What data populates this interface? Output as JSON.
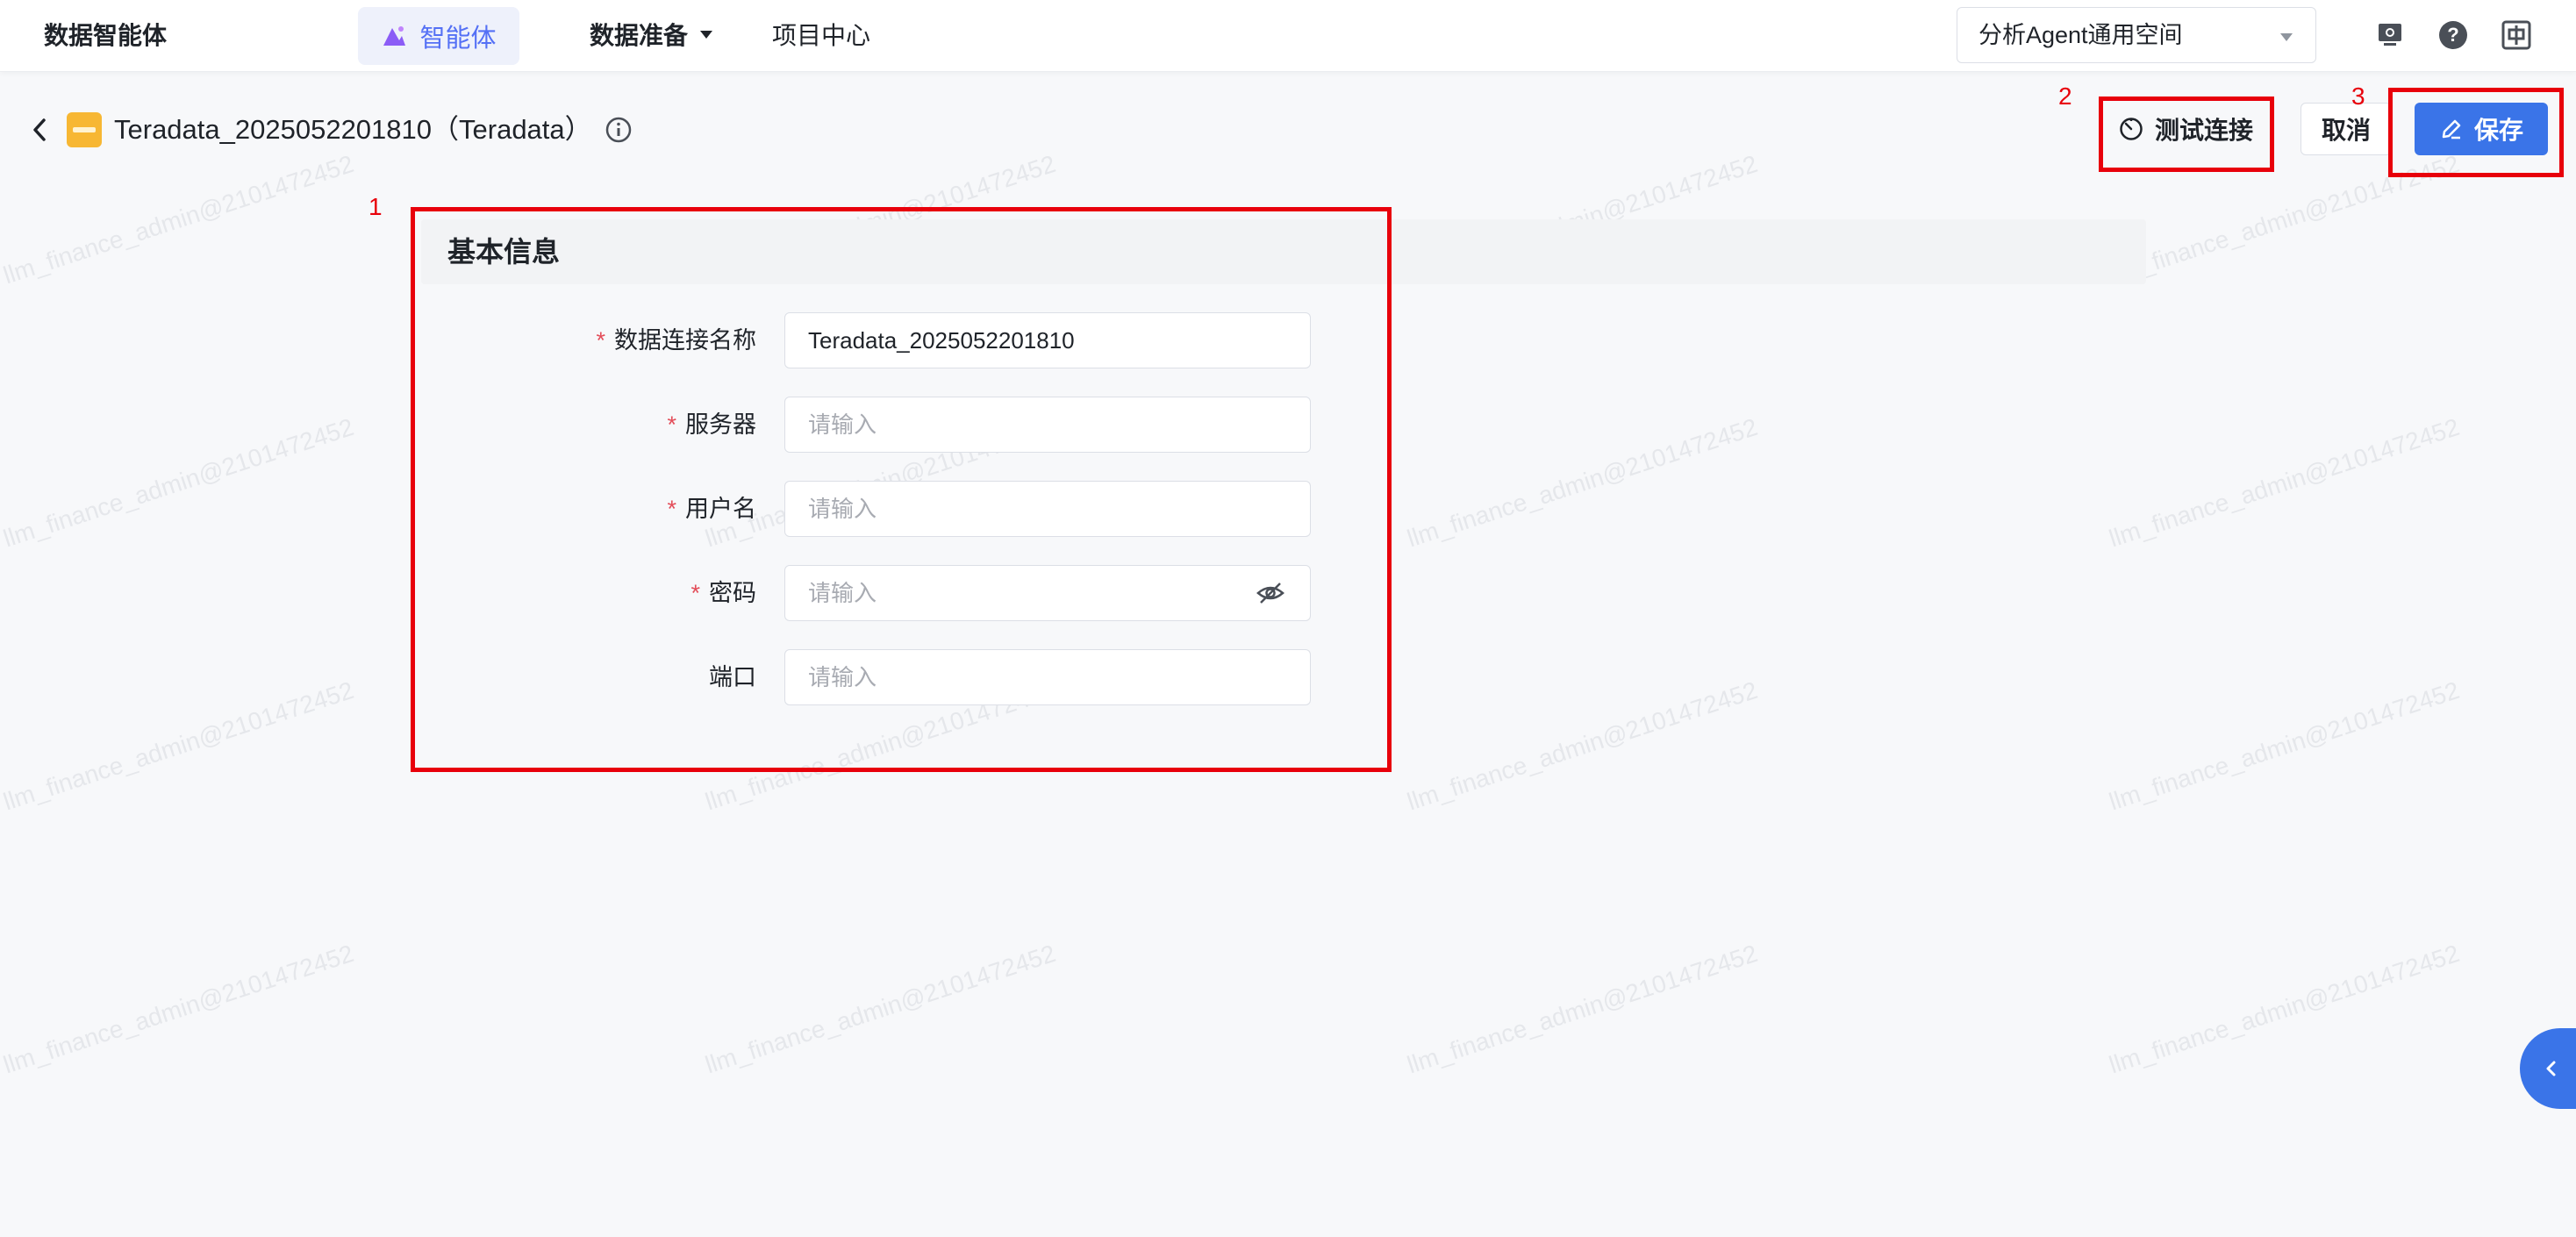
{
  "topbar": {
    "brand": "数据智能体",
    "nav_agent": "智能体",
    "nav_data": "数据准备",
    "nav_project": "项目中心",
    "space_select": "分析Agent通用空间",
    "icons": [
      "monitor-gear-icon",
      "help-icon",
      "language-zh-icon"
    ]
  },
  "header": {
    "title": "Teradata_2025052201810（Teradata）",
    "test_label": "测试连接",
    "cancel_label": "取消",
    "save_label": "保存"
  },
  "form": {
    "section_title": "基本信息",
    "fields": [
      {
        "label": "数据连接名称",
        "required": true,
        "value": "Teradata_2025052201810",
        "placeholder": ""
      },
      {
        "label": "服务器",
        "required": true,
        "value": "",
        "placeholder": "请输入"
      },
      {
        "label": "用户名",
        "required": true,
        "value": "",
        "placeholder": "请输入"
      },
      {
        "label": "密码",
        "required": true,
        "value": "",
        "placeholder": "请输入",
        "type": "password"
      },
      {
        "label": "端口",
        "required": false,
        "value": "",
        "placeholder": "请输入"
      }
    ],
    "required_mark": "*"
  },
  "annotations": [
    "1",
    "2",
    "3"
  ],
  "watermark": "llm_finance_admin@2101472452",
  "colors": {
    "primary": "#3a74e8",
    "agent_accent": "#5470f5",
    "annotation": "#e8000b",
    "required": "#e34d59",
    "logo": "#f7b733"
  }
}
